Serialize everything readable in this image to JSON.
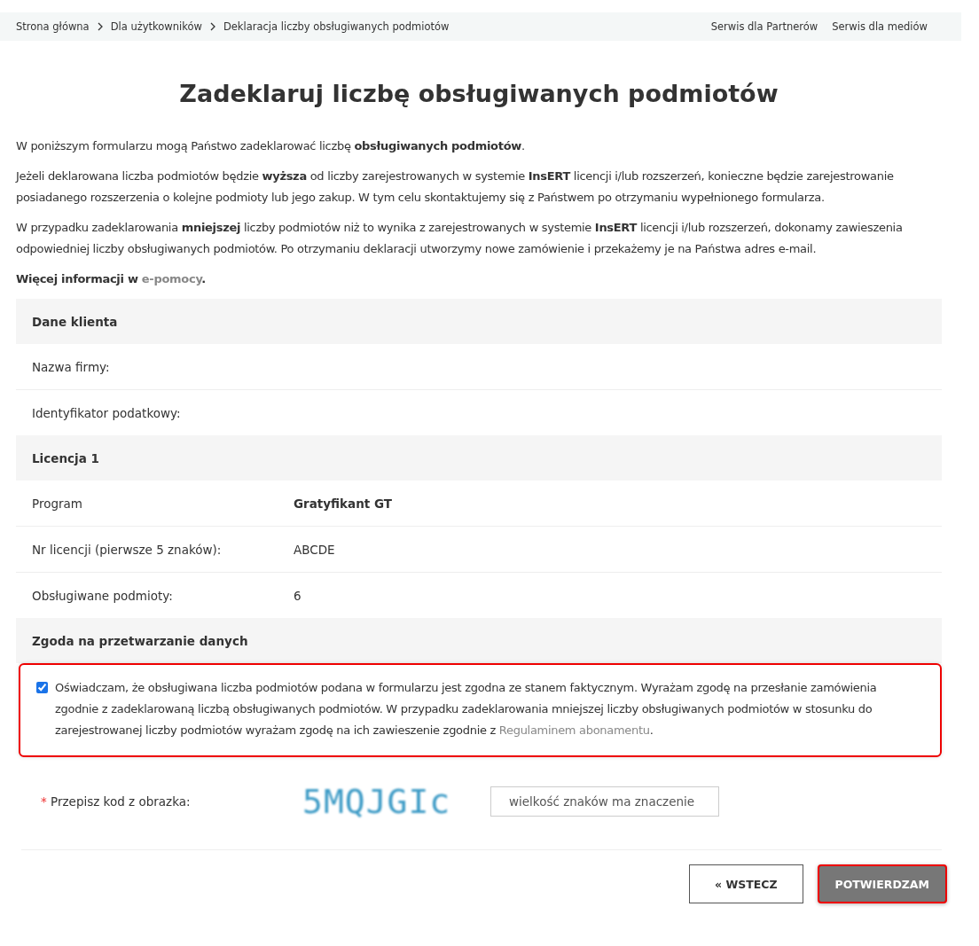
{
  "breadcrumb": [
    "Strona główna",
    "Dla użytkowników",
    "Deklaracja liczby obsługiwanych podmiotów"
  ],
  "top_links": [
    "Serwis dla Partnerów",
    "Serwis dla mediów"
  ],
  "title": "Zadeklaruj liczbę obsługiwanych podmiotów",
  "intro": [
    "W poniższym formularzu mogą Państwo zadeklarować liczbę **obsługiwanych podmiotów**.",
    "Jeżeli deklarowana liczba podmiotów będzie **wyższa** od liczby zarejestrowanych w systemie **InsERT** licencji i/lub rozszerzeń, konieczne będzie zarejestrowanie posiadanego rozszerzenia o kolejne podmioty lub jego zakup. W tym celu skontaktujemy się z Państwem po otrzymaniu wypełnionego formularza.",
    "W przypadku zadeklarowania **mniejszej** liczby podmiotów niż to wynika z zarejestrowanych w systemie **InsERT** licencji i/lub rozszerzeń, dokonamy zawieszenia odpowiedniej liczby obsługiwanych podmiotów. Po otrzymaniu deklaracji utworzymy nowe zamówienie i przekażemy je na Państwa adres e-mail."
  ],
  "more_info": {
    "text": "Więcej informacji w",
    "link": "e-pomocy",
    "end": "."
  },
  "sections": [
    {
      "heading": "Dane klienta",
      "rows": [
        {
          "label": "Nazwa firmy:"
        },
        {
          "label": "Identyfikator podatkowy:"
        }
      ]
    },
    {
      "heading": "Licencja 1",
      "rows": [
        {
          "label": "Program",
          "value": "Gratyfikant GT",
          "bold": true
        },
        {
          "label": "Nr licencji (pierwsze 5 znaków):",
          "value": "ABCDE",
          "bold": false
        },
        {
          "label": "Obsługiwane podmioty:",
          "value": "6",
          "bold": false
        }
      ]
    }
  ],
  "consent": {
    "heading": "Zgoda na przetwarzanie danych",
    "checked": true,
    "highlighted": true,
    "text": "Oświadczam, że obsługiwana liczba podmiotów podana w formularzu jest zgodna ze stanem faktycznym. Wyrażam zgodę na przesłanie zamówienia zgodnie z zadeklarowaną liczbą obsługiwanych podmiotów. W przypadku zadeklarowania mniejszej liczby obsługiwanych podmiotów w stosunku do zarejestrowanej liczby podmiotów wyrażam zgodę na ich zawieszenie zgodnie z",
    "link": "Regulaminem abonamentu",
    "end": "."
  },
  "captcha": {
    "required_mark": "*",
    "label": "Przepisz kod z obrazka:",
    "code": "5MQJGIc",
    "placeholder": "wielkość znaków ma znaczenie"
  },
  "buttons": [
    {
      "label": "« WSTECZ",
      "kind": "secondary",
      "highlighted": false
    },
    {
      "label": "POTWIERDZAM",
      "kind": "primary",
      "highlighted": true
    }
  ]
}
